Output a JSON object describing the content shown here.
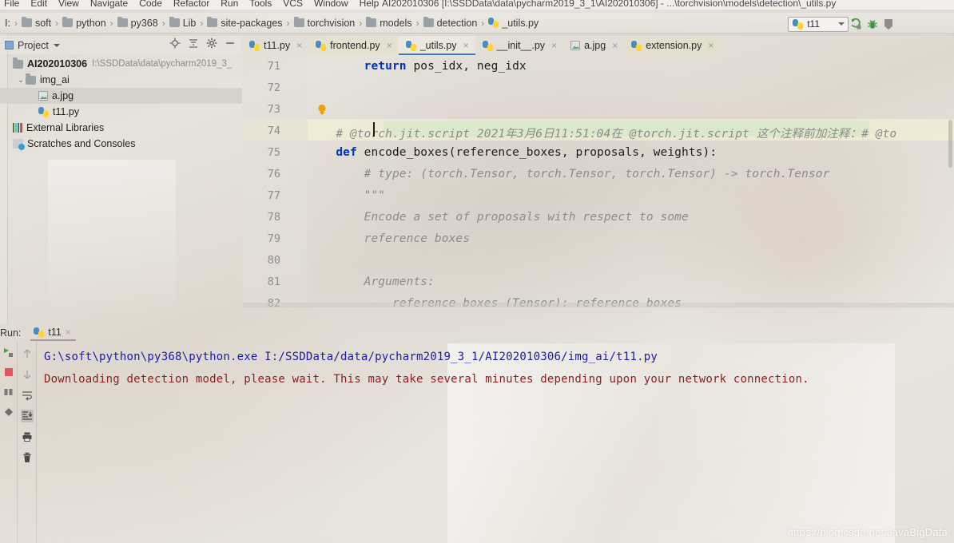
{
  "window": {
    "title": "AI202010306 [I:\\SSDData\\data\\pycharm2019_3_1\\AI202010306] - ...\\torchvision\\models\\detection\\_utils.py"
  },
  "menubar": {
    "items": [
      "File",
      "Edit",
      "View",
      "Navigate",
      "Code",
      "Refactor",
      "Run",
      "Tools",
      "VCS",
      "Window",
      "Help"
    ]
  },
  "breadcrumb": {
    "root": "I:",
    "items": [
      {
        "label": "soft",
        "icon": "folder-icon"
      },
      {
        "label": "python",
        "icon": "folder-icon"
      },
      {
        "label": "py368",
        "icon": "folder-icon"
      },
      {
        "label": "Lib",
        "icon": "folder-icon"
      },
      {
        "label": "site-packages",
        "icon": "folder-icon"
      },
      {
        "label": "torchvision",
        "icon": "folder-icon"
      },
      {
        "label": "models",
        "icon": "folder-icon"
      },
      {
        "label": "detection",
        "icon": "folder-icon"
      },
      {
        "label": "_utils.py",
        "icon": "python-file-icon"
      }
    ],
    "separator": "›"
  },
  "toolbar": {
    "run_config_name": "t11",
    "run_config_icon": "python-run-config-icon",
    "dropdown_icon": "chevron-down-icon",
    "run_icon": "run-icon",
    "debug_icon": "debug-bug-icon",
    "more_icon": "more-icon"
  },
  "project_panel": {
    "title": "Project",
    "caret_icon": "chevron-down-icon",
    "actions": [
      "locate-icon",
      "collapse-all-icon",
      "settings-gear-icon",
      "hide-icon"
    ],
    "tree": [
      {
        "label": "AI202010306",
        "path": "I:\\SSDData\\data\\pycharm2019_3_",
        "icon": "folder-icon",
        "indent": 0,
        "bold": true,
        "arrow": "",
        "selected": false
      },
      {
        "label": "img_ai",
        "path": "",
        "icon": "folder-icon",
        "indent": 1,
        "bold": false,
        "arrow": "⌄",
        "selected": false
      },
      {
        "label": "a.jpg",
        "path": "",
        "icon": "image-file-icon",
        "indent": 2,
        "bold": false,
        "arrow": "",
        "selected": true
      },
      {
        "label": "t11.py",
        "path": "",
        "icon": "python-file-icon",
        "indent": 2,
        "bold": false,
        "arrow": "",
        "selected": false
      },
      {
        "label": "External Libraries",
        "path": "",
        "icon": "libraries-icon",
        "indent": 0,
        "bold": false,
        "arrow": "",
        "selected": false
      },
      {
        "label": "Scratches and Consoles",
        "path": "",
        "icon": "scratches-icon",
        "indent": 0,
        "bold": false,
        "arrow": "",
        "selected": false
      }
    ]
  },
  "editor": {
    "tabs": [
      {
        "label": "t11.py",
        "icon": "python-file-icon",
        "active": false,
        "modified_bg": false
      },
      {
        "label": "frontend.py",
        "icon": "python-file-icon",
        "active": false,
        "modified_bg": true
      },
      {
        "label": "_utils.py",
        "icon": "python-file-icon",
        "active": true,
        "modified_bg": false
      },
      {
        "label": "__init__.py",
        "icon": "python-file-icon",
        "active": false,
        "modified_bg": false
      },
      {
        "label": "a.jpg",
        "icon": "image-file-icon",
        "active": false,
        "modified_bg": false
      },
      {
        "label": "extension.py",
        "icon": "python-file-icon",
        "active": false,
        "modified_bg": true
      }
    ],
    "close_icon": "×",
    "intention_bulb_icon": "lightbulb-icon",
    "lines": [
      {
        "no": "71",
        "text": "        return pos_idx, neg_idx",
        "kind": "code"
      },
      {
        "no": "72",
        "text": "",
        "kind": "blank"
      },
      {
        "no": "73",
        "text": "",
        "kind": "blank"
      },
      {
        "no": "74",
        "text": "    # @torch.jit.script 2021年3月6日11:51:04在 @torch.jit.script 这个注释前加注释：# @to",
        "kind": "comment"
      },
      {
        "no": "75",
        "text": "    def encode_boxes(reference_boxes, proposals, weights):",
        "kind": "code"
      },
      {
        "no": "76",
        "text": "        # type: (torch.Tensor, torch.Tensor, torch.Tensor) -> torch.Tensor",
        "kind": "comment"
      },
      {
        "no": "77",
        "text": "        \"\"\"",
        "kind": "docstring"
      },
      {
        "no": "78",
        "text": "        Encode a set of proposals with respect to some",
        "kind": "docstring"
      },
      {
        "no": "79",
        "text": "        reference boxes",
        "kind": "docstring"
      },
      {
        "no": "80",
        "text": "",
        "kind": "blank"
      },
      {
        "no": "81",
        "text": "        Arguments:",
        "kind": "docstring"
      },
      {
        "no": "82",
        "text": "            reference_boxes (Tensor): reference boxes",
        "kind": "docstring"
      }
    ],
    "highlighted_line": "74",
    "keywords": {
      "k71": "return",
      "k75": "def"
    },
    "code_71_rest": " pos_idx, neg_idx",
    "code_75_rest": " encode_boxes(reference_boxes, proposals, weights):"
  },
  "run_panel": {
    "label": "Run:",
    "tab_name": "t11",
    "tab_icon": "python-run-config-icon",
    "close_icon": "×",
    "left_tools": [
      "rerun-icon",
      "stop-icon",
      "resume-icon",
      "pin-icon"
    ],
    "right_tools": [
      "scroll-up-icon",
      "scroll-down-icon",
      "soft-wrap-icon",
      "scroll-to-end-icon",
      "print-icon",
      "clear-all-icon"
    ],
    "console_lines": [
      {
        "text": "G:\\soft\\python\\py368\\python.exe I:/SSDData/data/pycharm2019_3_1/AI202010306/img_ai/t11.py",
        "color": "#1a1aa6"
      },
      {
        "text": "Downloading detection model, please wait. This may take several minutes depending upon your network connection.",
        "color": "#8b1f1f"
      }
    ]
  },
  "watermark": {
    "text": "https://blog.csdn.net/JavaBigData"
  }
}
